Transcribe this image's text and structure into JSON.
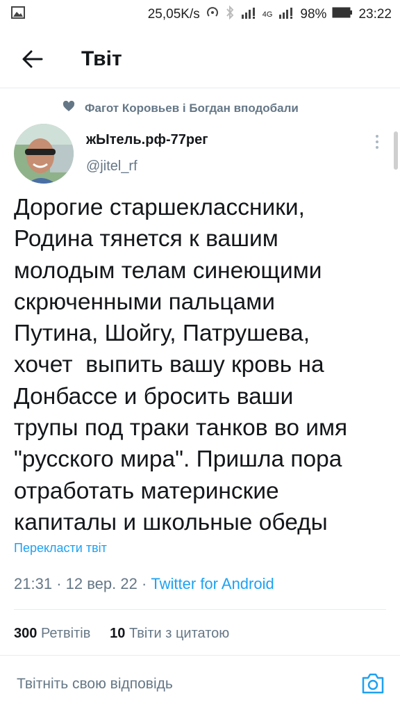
{
  "status_bar": {
    "speed": "25,05K/s",
    "network": "4G",
    "battery": "98%",
    "time": "23:22"
  },
  "header": {
    "title": "Твіт"
  },
  "liked_by": "Фагот Коровьев і Богдан вподобали",
  "author": {
    "name": "жЫтель.рф-77рег",
    "handle": "@jitel_rf"
  },
  "tweet": {
    "text": "Дорогие старшеклассники,\nРодина тянется к вашим\nмолодым телам синеющими\nскрюченными пальцами\nПутина, Шойгу, Патрушева,\nхочет  выпить вашу кровь на\nДонбассе и бросить ваши\nтрупы под траки танков во имя\n\"русского мира\". Пришла пора\nотработать материнские\nкапиталы и школьные обеды",
    "translate": "Перекласти твіт",
    "time": "21:31",
    "date": "12 вер. 22",
    "source": "Twitter for Android"
  },
  "stats": {
    "retweets_count": "300",
    "retweets_label": "Ретвітів",
    "quotes_count": "10",
    "quotes_label": "Твіти з цитатою"
  },
  "reply": {
    "placeholder": "Твітніть свою відповідь"
  },
  "icons": {
    "back": "arrow-left-icon",
    "liked": "heart-icon",
    "more": "more-vertical-icon",
    "camera": "camera-icon"
  },
  "colors": {
    "accent": "#1da1f2",
    "secondary_text": "#657786",
    "primary_text": "#14171a"
  }
}
